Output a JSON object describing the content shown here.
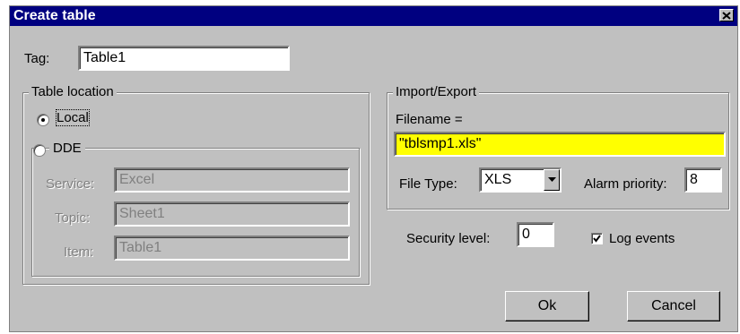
{
  "window": {
    "title": "Create table"
  },
  "tag": {
    "label": "Tag:",
    "value": "Table1"
  },
  "table_location": {
    "title": "Table location",
    "local_label": "Local",
    "dde_label": "DDE",
    "selected": "Local",
    "service": {
      "label": "Service:",
      "value": "Excel"
    },
    "topic": {
      "label": "Topic:",
      "value": "Sheet1"
    },
    "item": {
      "label": "Item:",
      "value": "Table1"
    }
  },
  "import_export": {
    "title": "Import/Export",
    "filename_label": "Filename =",
    "filename_value": "\"tblsmp1.xls\"",
    "file_type_label": "File Type:",
    "file_type_value": "XLS",
    "alarm_priority_label": "Alarm priority:",
    "alarm_priority_value": "8"
  },
  "security": {
    "label": "Security level:",
    "value": "0"
  },
  "log_events": {
    "label": "Log events",
    "checked": true
  },
  "buttons": {
    "ok": "Ok",
    "cancel": "Cancel"
  },
  "colors": {
    "titlebar": "#000080",
    "face": "#c0c0c0",
    "filename_highlight": "#ffff00"
  },
  "icons": {
    "close": "close-icon",
    "dropdown": "chevron-down-icon",
    "check": "checkmark-icon"
  }
}
